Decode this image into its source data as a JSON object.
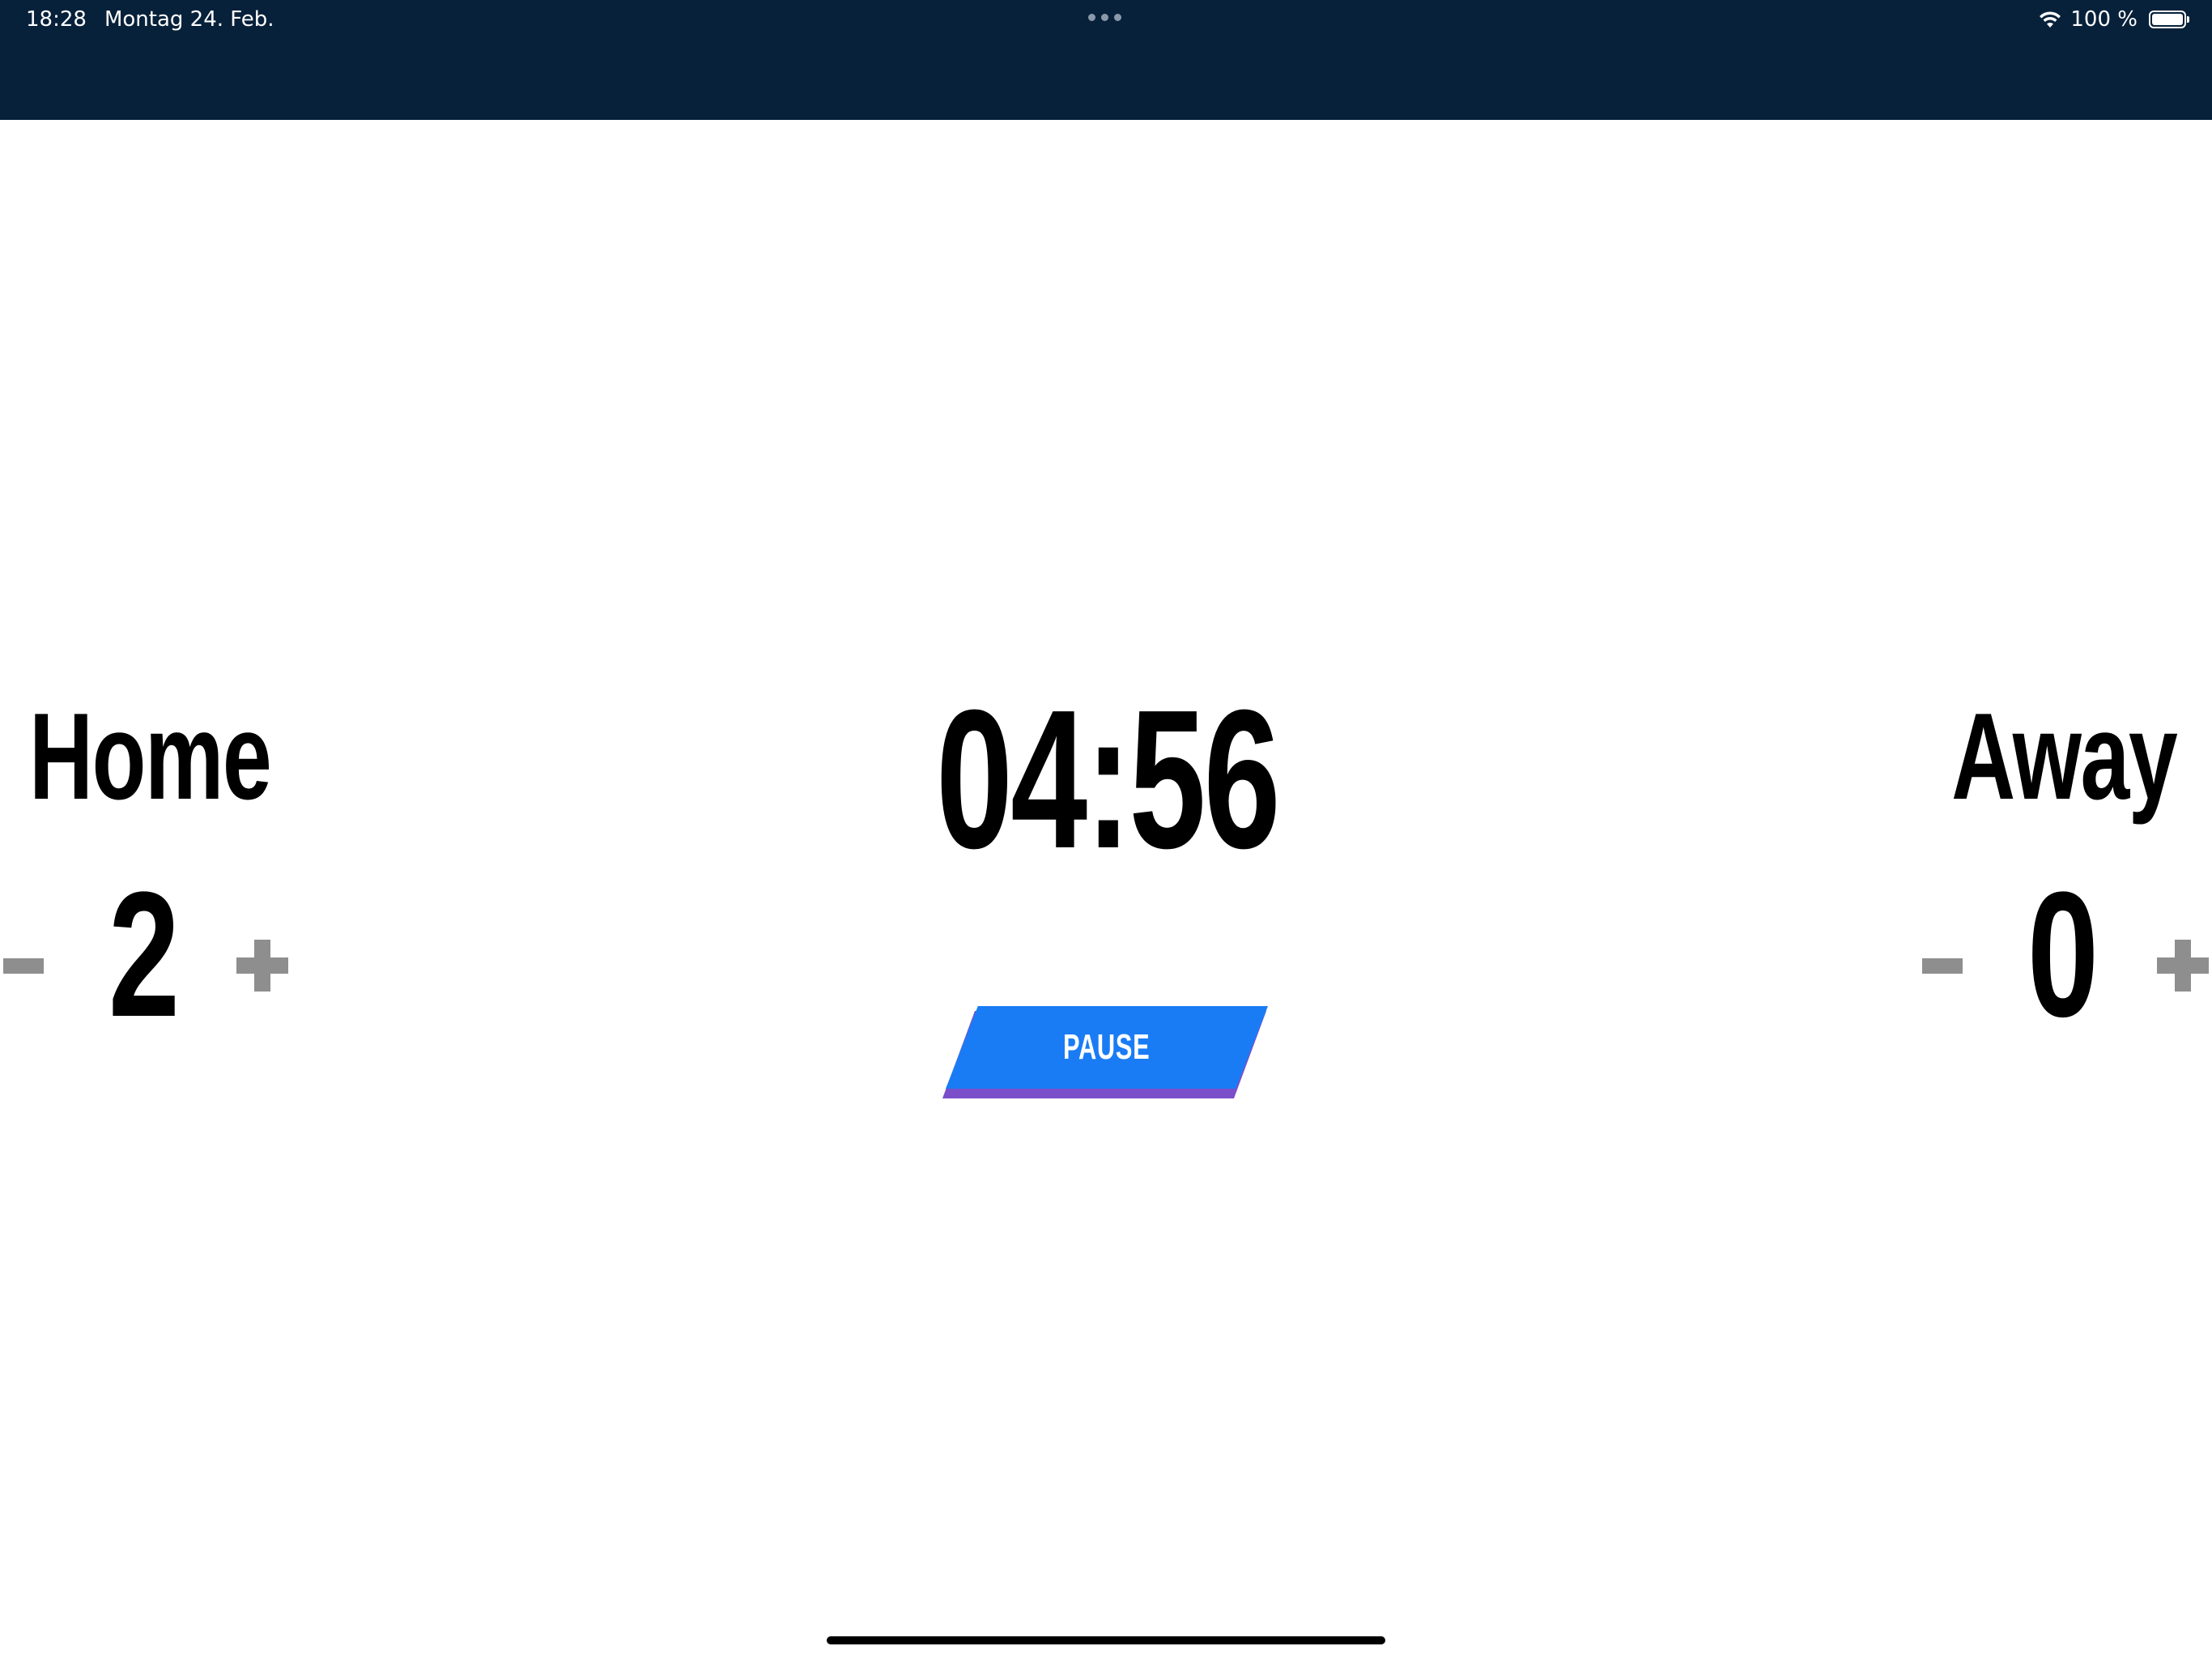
{
  "status_bar": {
    "time": "18:28",
    "date": "Montag 24. Feb.",
    "battery_text": "100 %",
    "battery_level": 1.0,
    "wifi_icon": "wifi-icon"
  },
  "home": {
    "name": "Home",
    "score": "2",
    "minus_symbol": "minus-icon",
    "plus_symbol": "plus-icon"
  },
  "away": {
    "name": "Away",
    "score": "0",
    "minus_symbol": "minus-icon",
    "plus_symbol": "plus-icon"
  },
  "timer": {
    "value": "04:56"
  },
  "pause_button": {
    "label": "PAUSE",
    "color": "#1a7cf5",
    "shadow_color": "#7a4fc9"
  },
  "colors": {
    "status_bar_bg": "#08213a",
    "score_button_gray": "#8e8e8e"
  }
}
